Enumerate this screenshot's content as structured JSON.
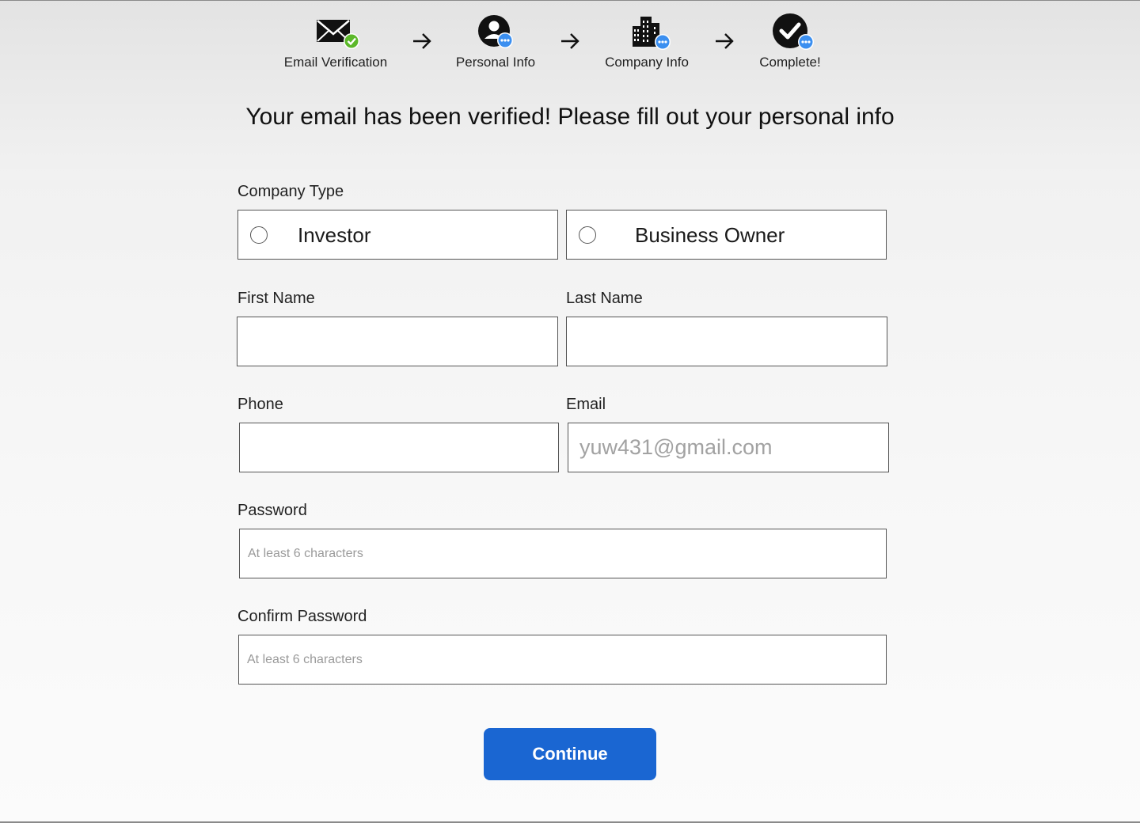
{
  "stepper": {
    "steps": [
      {
        "label": "Email Verification",
        "icon": "envelope-check-icon",
        "status": "done"
      },
      {
        "label": "Personal Info",
        "icon": "user-pending-icon",
        "status": "current"
      },
      {
        "label": "Company Info",
        "icon": "building-pending-icon",
        "status": "pending"
      },
      {
        "label": "Complete!",
        "icon": "checkmark-pending-icon",
        "status": "pending"
      }
    ]
  },
  "heading": "Your email has been verified! Please fill out your personal info",
  "form": {
    "company_type": {
      "label": "Company Type",
      "options": [
        "Investor",
        "Business Owner"
      ],
      "selected": null
    },
    "first_name": {
      "label": "First Name",
      "value": "",
      "placeholder": ""
    },
    "last_name": {
      "label": "Last Name",
      "value": "",
      "placeholder": ""
    },
    "phone": {
      "label": "Phone",
      "value": "",
      "placeholder": ""
    },
    "email": {
      "label": "Email",
      "value": "",
      "placeholder": "yuw431@gmail.com"
    },
    "password": {
      "label": "Password",
      "value": "",
      "placeholder": "At least 6 characters"
    },
    "confirm_password": {
      "label": "Confirm Password",
      "value": "",
      "placeholder": "At least 6 characters"
    }
  },
  "continue_label": "Continue",
  "colors": {
    "primary": "#1a66d2",
    "success": "#5cb82a",
    "pending": "#3b8ff0"
  }
}
